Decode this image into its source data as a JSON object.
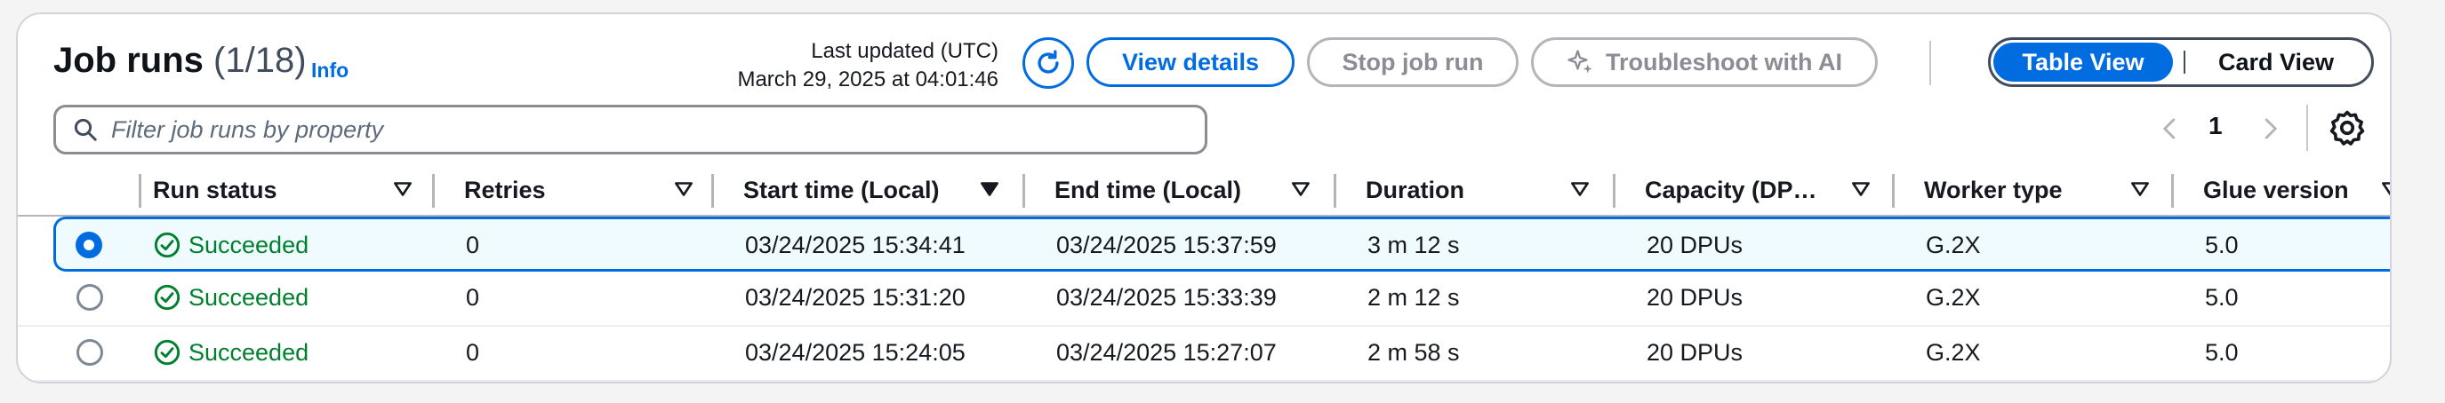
{
  "header": {
    "title": "Job runs",
    "count": "(1/18)",
    "info_link": "Info",
    "last_updated_label": "Last updated (UTC)",
    "last_updated_value": "March 29, 2025 at 04:01:46"
  },
  "actions": {
    "view_details": "View details",
    "stop_job_run": "Stop job run",
    "troubleshoot": "Troubleshoot with AI"
  },
  "view_toggle": {
    "table": "Table View",
    "card": "Card View",
    "selected": "Table View"
  },
  "filter": {
    "placeholder": "Filter job runs by property"
  },
  "pagination": {
    "current_page": "1"
  },
  "table": {
    "columns": [
      "Run status",
      "Retries",
      "Start time (Local)",
      "End time (Local)",
      "Duration",
      "Capacity (DP…",
      "Worker type",
      "Glue version"
    ],
    "sorted_column": "Start time (Local)",
    "rows": [
      {
        "selected": true,
        "status": "Succeeded",
        "retries": "0",
        "start": "03/24/2025 15:34:41",
        "end": "03/24/2025 15:37:59",
        "duration": "3 m 12 s",
        "capacity": "20 DPUs",
        "worker": "G.2X",
        "glue": "5.0"
      },
      {
        "selected": false,
        "status": "Succeeded",
        "retries": "0",
        "start": "03/24/2025 15:31:20",
        "end": "03/24/2025 15:33:39",
        "duration": "2 m 12 s",
        "capacity": "20 DPUs",
        "worker": "G.2X",
        "glue": "5.0"
      },
      {
        "selected": false,
        "status": "Succeeded",
        "retries": "0",
        "start": "03/24/2025 15:24:05",
        "end": "03/24/2025 15:27:07",
        "duration": "2 m 58 s",
        "capacity": "20 DPUs",
        "worker": "G.2X",
        "glue": "5.0"
      }
    ]
  },
  "icons": [
    "refresh-icon",
    "sparkle-icon",
    "search-icon",
    "chevron-left-icon",
    "chevron-right-icon",
    "settings-icon",
    "sort-icon",
    "success-check-icon"
  ],
  "colors": {
    "accent": "#006ce0",
    "success": "#00802f",
    "disabled": "#8c8c94",
    "selected_row_bg": "#f0fbff"
  }
}
